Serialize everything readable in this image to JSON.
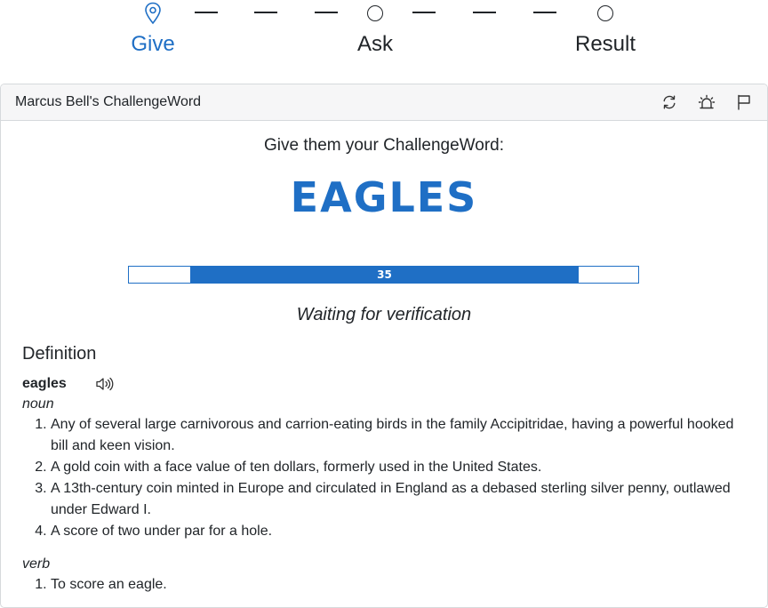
{
  "stepper": {
    "steps": [
      {
        "label": "Give",
        "state": "active",
        "icon": "map-pin-icon"
      },
      {
        "label": "Ask",
        "state": "pending",
        "icon": "circle-icon"
      },
      {
        "label": "Result",
        "state": "pending",
        "icon": "circle-icon"
      }
    ],
    "accent": "#1f6fc5"
  },
  "card": {
    "title": "Marcus Bell's ChallengeWord",
    "actions": [
      {
        "name": "refresh-icon"
      },
      {
        "name": "alarm-icon"
      },
      {
        "name": "flag-icon"
      }
    ],
    "prompt": "Give them your ChallengeWord:",
    "word": "EAGLES",
    "progress": {
      "value": 35,
      "fill_fraction": 0.76
    },
    "status": "Waiting for verification",
    "definition": {
      "heading": "Definition",
      "headword": "eagles",
      "audio_icon": "speaker-icon",
      "noun_label": "noun",
      "noun_senses": [
        "Any of several large carnivorous and carrion-eating birds in the family Accipitridae, having a powerful hooked bill and keen vision.",
        "A gold coin with a face value of ten dollars, formerly used in the United States.",
        "A 13th-century coin minted in Europe and circulated in England as a debased sterling silver penny, outlawed under Edward I.",
        "A score of two under par for a hole."
      ],
      "verb_label": "verb",
      "verb_senses": [
        "To score an eagle."
      ]
    }
  }
}
